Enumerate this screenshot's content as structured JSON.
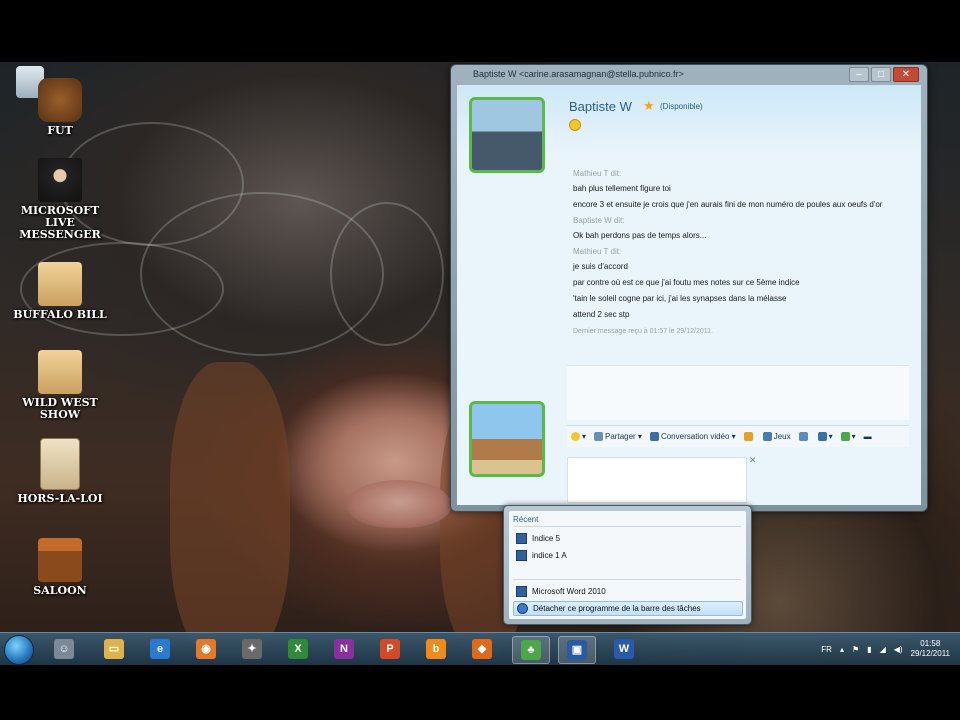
{
  "desktop": {
    "icons": [
      {
        "label": "FUT",
        "icon": "barrel-icon"
      },
      {
        "label": "MICROSOFT LIVE MESSENGER",
        "icon": "cowboy-icon"
      },
      {
        "label": "BUFFALO BILL",
        "icon": "folder-icon"
      },
      {
        "label": "WILD WEST SHOW",
        "icon": "folder-icon"
      },
      {
        "label": "HORS-LA-LOI",
        "icon": "wanted-poster-icon"
      },
      {
        "label": "SALOON",
        "icon": "saloon-icon"
      }
    ]
  },
  "messenger": {
    "title": "Baptiste W <carine.arasamagnan@stella.pubnico.fr>",
    "contact_name": "Baptiste W",
    "status": "(Disponible)",
    "conversation": [
      {
        "type": "who",
        "text": "Mathieu T dit:"
      },
      {
        "type": "msg",
        "text": "bah plus tellement figure toi"
      },
      {
        "type": "msg",
        "text": "encore 3 et ensuite je crois que j'en aurais fini de mon numéro de poules aux oeufs d'or"
      },
      {
        "type": "who",
        "text": "Baptiste W dit:"
      },
      {
        "type": "msg",
        "text": "Ok bah perdons pas de temps alors..."
      },
      {
        "type": "who",
        "text": "Mathieu T dit:"
      },
      {
        "type": "msg",
        "text": "je suis d'accord"
      },
      {
        "type": "msg",
        "text": "par contre où est ce que j'ai foutu mes notes sur ce 5ème indice"
      },
      {
        "type": "msg",
        "text": "'tain le soleil cogne par ici, j'ai les synapses dans la mélasse"
      },
      {
        "type": "msg",
        "text": "attend 2 sec stp"
      }
    ],
    "last_message": "Dernier message reçu à 01:57 le 29/12/2011.",
    "toolbar": {
      "share": "Partager",
      "video": "Conversation vidéo",
      "games": "Jeux"
    }
  },
  "jumplist": {
    "header": "Récent",
    "recent": [
      "Indice 5",
      "indice 1 A"
    ],
    "program": "Microsoft Word 2010",
    "unpin": "Détacher ce programme de la barre des tâches"
  },
  "taskbar": {
    "language": "FR",
    "time": "01:58",
    "date": "29/12/2011",
    "apps": [
      {
        "name": "messenger-icon",
        "color": "#7a8a96",
        "glyph": "☺"
      },
      {
        "name": "explorer-icon",
        "color": "#e0b24a",
        "glyph": "▭"
      },
      {
        "name": "internet-explorer-icon",
        "color": "#2a7bd0",
        "glyph": "e"
      },
      {
        "name": "media-icon",
        "color": "#e27a2a",
        "glyph": "◉"
      },
      {
        "name": "app-icon",
        "color": "#6a6a6a",
        "glyph": "✦"
      },
      {
        "name": "excel-icon",
        "color": "#2f8a3a",
        "glyph": "X"
      },
      {
        "name": "onenote-icon",
        "color": "#8a2f9e",
        "glyph": "N"
      },
      {
        "name": "powerpoint-icon",
        "color": "#d24a26",
        "glyph": "P"
      },
      {
        "name": "bing-icon",
        "color": "#f08a1a",
        "glyph": "b"
      },
      {
        "name": "app-icon",
        "color": "#e06a1a",
        "glyph": "◆"
      },
      {
        "name": "live-messenger-icon",
        "color": "#4aa84a",
        "glyph": "♣"
      },
      {
        "name": "remote-icon",
        "color": "#2a5aa0",
        "glyph": "▣"
      },
      {
        "name": "word-icon",
        "color": "#2b5aa8",
        "glyph": "W"
      }
    ]
  }
}
